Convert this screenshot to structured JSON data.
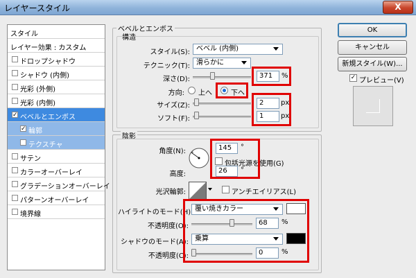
{
  "window": {
    "title": "レイヤースタイル",
    "close_label": "X"
  },
  "left_panel": {
    "header": "スタイル",
    "items": [
      {
        "label": "レイヤー効果 : カスタム",
        "checkbox": false,
        "checked": false,
        "state": "normal"
      },
      {
        "label": "ドロップシャドウ",
        "checkbox": true,
        "checked": false,
        "state": "normal"
      },
      {
        "label": "シャドウ (内側)",
        "checkbox": true,
        "checked": false,
        "state": "normal"
      },
      {
        "label": "光彩 (外側)",
        "checkbox": true,
        "checked": false,
        "state": "normal"
      },
      {
        "label": "光彩 (内側)",
        "checkbox": true,
        "checked": false,
        "state": "normal"
      },
      {
        "label": "ベベルとエンボス",
        "checkbox": true,
        "checked": true,
        "state": "selected"
      },
      {
        "label": "輪郭",
        "checkbox": true,
        "checked": true,
        "state": "sub"
      },
      {
        "label": "テクスチャ",
        "checkbox": true,
        "checked": false,
        "state": "sub"
      },
      {
        "label": "サテン",
        "checkbox": true,
        "checked": false,
        "state": "normal"
      },
      {
        "label": "カラーオーバーレイ",
        "checkbox": true,
        "checked": false,
        "state": "normal"
      },
      {
        "label": "グラデーションオーバーレイ",
        "checkbox": true,
        "checked": false,
        "state": "normal"
      },
      {
        "label": "パターンオーバーレイ",
        "checkbox": true,
        "checked": false,
        "state": "normal"
      },
      {
        "label": "境界線",
        "checkbox": true,
        "checked": false,
        "state": "normal"
      }
    ]
  },
  "bevel": {
    "section_title": "ベベルとエンボス",
    "structure_title": "構造",
    "style_label": "スタイル(S):",
    "style_value": "ベベル (内側)",
    "technique_label": "テクニック(T):",
    "technique_value": "滑らかに",
    "depth_label": "深さ(D):",
    "depth_value": "371",
    "depth_unit": "%",
    "depth_slider": 0.33,
    "direction_label": "方向:",
    "direction_up": "上へ",
    "direction_down": "下へ",
    "direction_selected": "down",
    "size_label": "サイズ(Z):",
    "size_value": "2",
    "size_unit": "px",
    "size_slider": 0.02,
    "soften_label": "ソフト(F):",
    "soften_value": "1",
    "soften_unit": "px",
    "soften_slider": 0.02
  },
  "shading": {
    "title": "陰影",
    "angle_label": "角度(N):",
    "angle_value": "145",
    "angle_unit": "°",
    "global_light_label": "包括光源を使用(G)",
    "altitude_label": "高度:",
    "altitude_value": "26",
    "altitude_unit": "°",
    "gloss_label": "光沢輪郭:",
    "antialias_label": "アンチエイリアス(L)",
    "highlight_mode_label": "ハイライトのモード(H):",
    "highlight_mode_value": "覆い焼きカラー",
    "highlight_color": "#ffffff",
    "highlight_opacity_label": "不透明度(O):",
    "highlight_opacity_value": "68",
    "highlight_opacity_unit": "%",
    "highlight_opacity_slider": 0.68,
    "shadow_mode_label": "シャドウのモード(A):",
    "shadow_mode_value": "乗算",
    "shadow_color": "#000000",
    "shadow_opacity_label": "不透明度(C):",
    "shadow_opacity_value": "0",
    "shadow_opacity_unit": "%",
    "shadow_opacity_slider": 0.0
  },
  "buttons": {
    "ok": "OK",
    "cancel": "キャンセル",
    "new_style": "新規スタイル(W)...",
    "preview": "プレビュー(V)",
    "preview_checked": true
  },
  "colors": {
    "highlight_box": "#e00000",
    "selection": "#3e8ae0"
  }
}
